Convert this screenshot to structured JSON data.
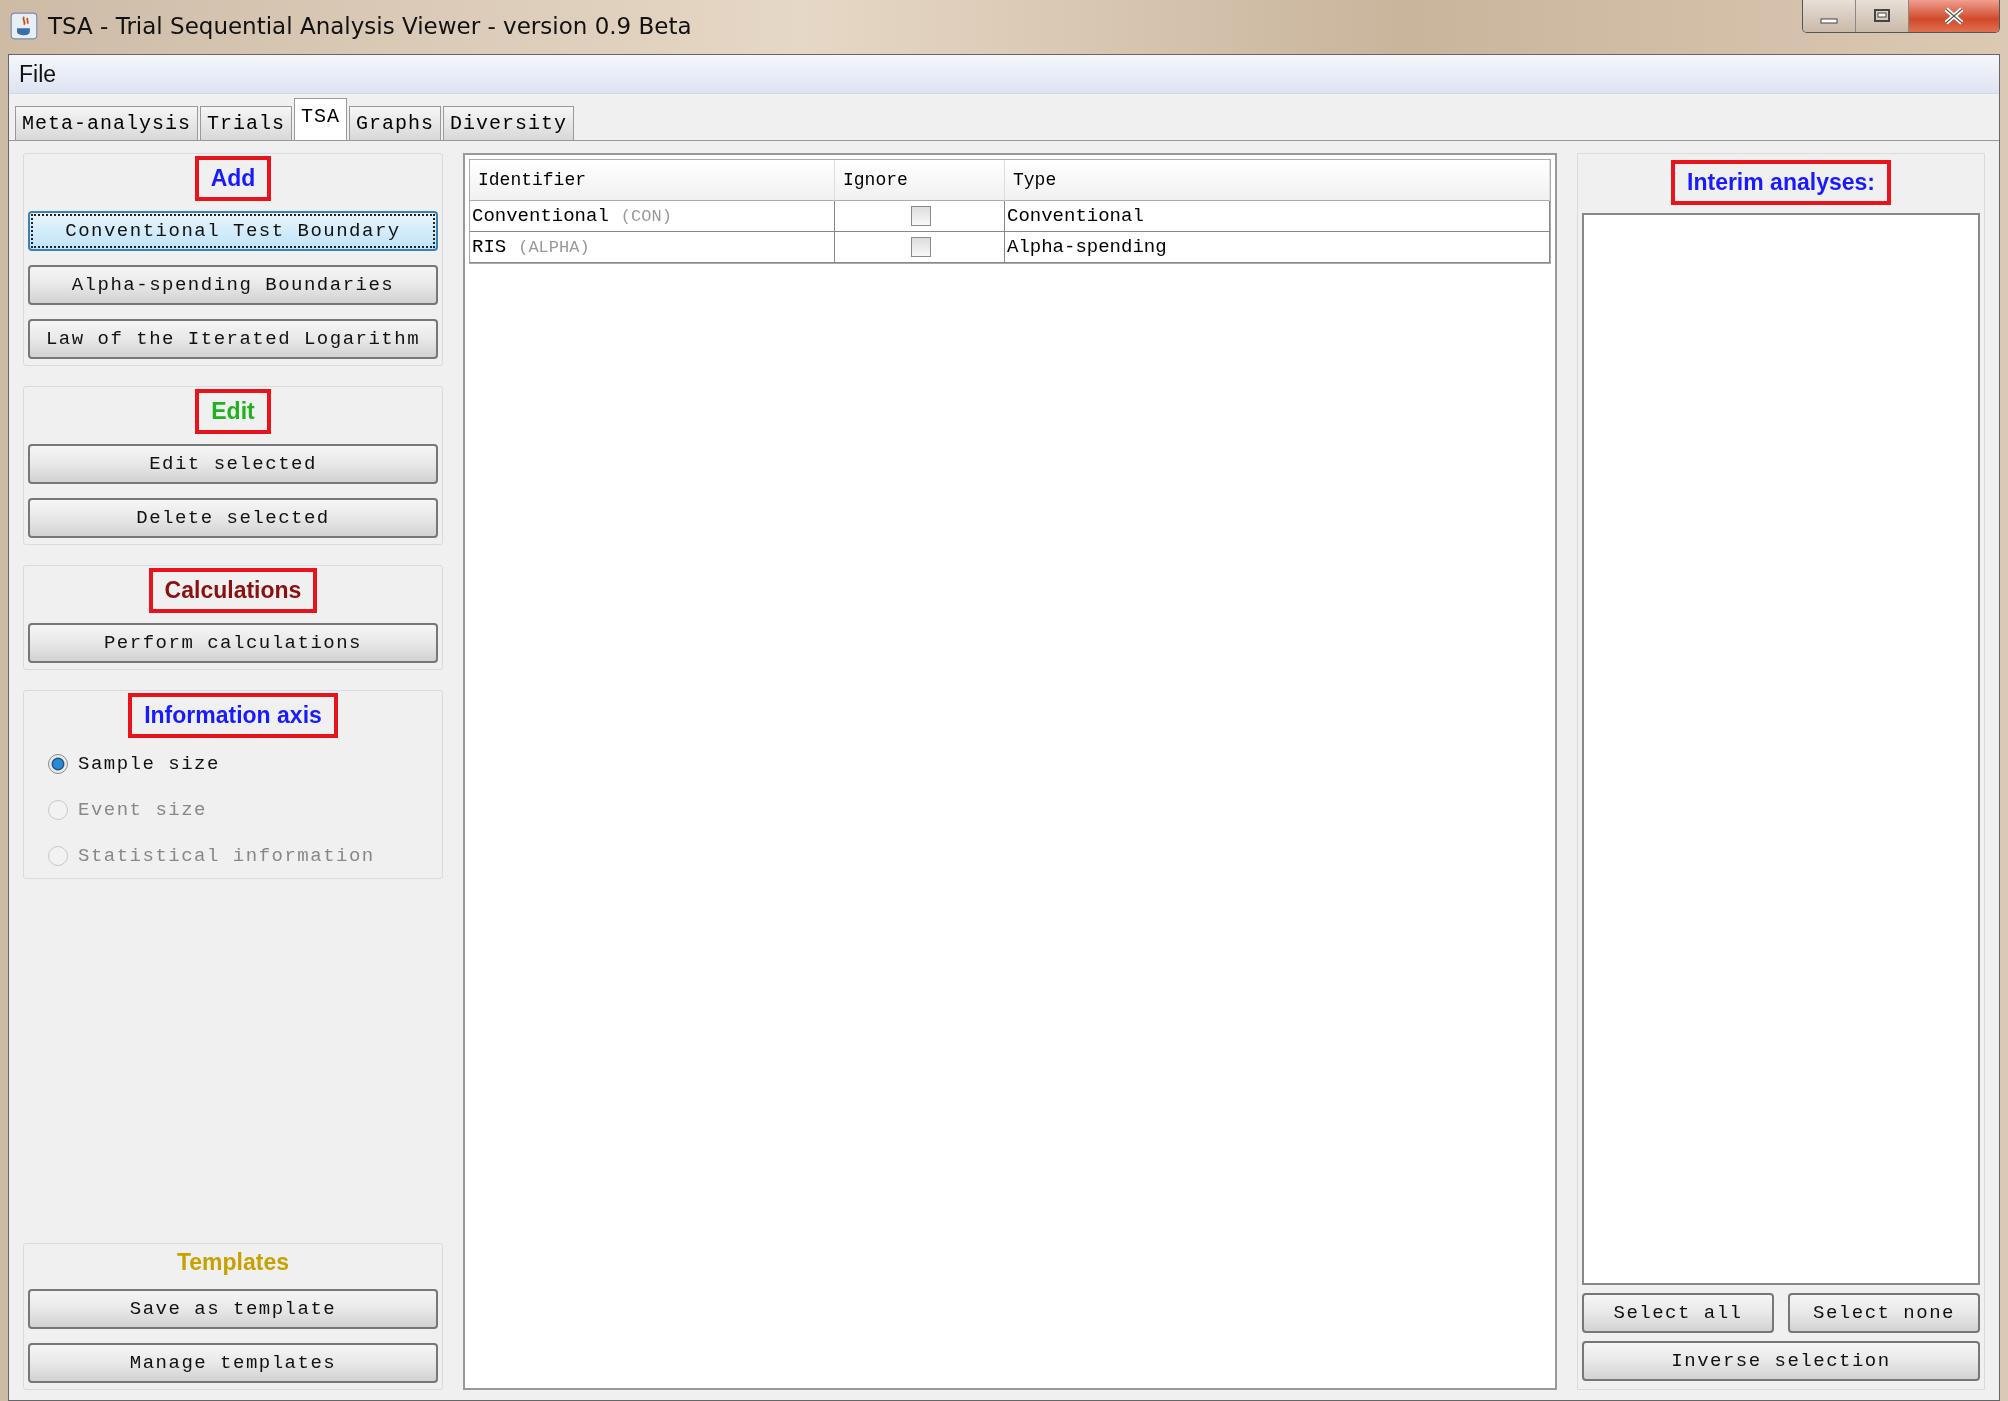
{
  "window": {
    "title": "TSA - Trial Sequential Analysis Viewer - version 0.9 Beta"
  },
  "menu": [
    "File"
  ],
  "tabs": [
    {
      "label": "Meta-analysis",
      "selected": false
    },
    {
      "label": "Trials",
      "selected": false
    },
    {
      "label": "TSA",
      "selected": true
    },
    {
      "label": "Graphs",
      "selected": false
    },
    {
      "label": "Diversity",
      "selected": false
    }
  ],
  "left_groups": [
    {
      "heading": "Add",
      "color": "#1a1aff",
      "highlighted": true,
      "kind": "buttons",
      "buttons": [
        {
          "label": "Conventional Test Boundary",
          "focused": true
        },
        {
          "label": "Alpha-spending Boundaries",
          "focused": false
        },
        {
          "label": "Law of the Iterated Logarithm",
          "focused": false
        }
      ]
    },
    {
      "heading": "Edit",
      "color": "#20b020",
      "highlighted": true,
      "kind": "buttons",
      "buttons": [
        {
          "label": "Edit selected",
          "focused": false
        },
        {
          "label": "Delete selected",
          "focused": false
        }
      ]
    },
    {
      "heading": "Calculations",
      "color": "#8b1010",
      "highlighted": true,
      "kind": "buttons",
      "buttons": [
        {
          "label": "Perform calculations",
          "focused": false
        }
      ]
    },
    {
      "heading": "Information axis",
      "color": "#1a1aff",
      "highlighted": true,
      "kind": "radios",
      "options": [
        {
          "label": "Sample size",
          "selected": true,
          "disabled": false
        },
        {
          "label": "Event size",
          "selected": false,
          "disabled": true
        },
        {
          "label": "Statistical information",
          "selected": false,
          "disabled": true
        }
      ]
    }
  ],
  "bottom_group": {
    "heading": "Templates",
    "color": "#c8a000",
    "highlighted": false,
    "kind": "buttons",
    "buttons": [
      {
        "label": "Save as template",
        "focused": false
      },
      {
        "label": "Manage templates",
        "focused": false
      }
    ]
  },
  "table": {
    "columns": [
      "Identifier",
      "Ignore",
      "Type"
    ],
    "rows": [
      {
        "identifier": "Conventional",
        "code": "(CON)",
        "ignore": false,
        "type": "Conventional"
      },
      {
        "identifier": "RIS",
        "code": "(ALPHA)",
        "ignore": false,
        "type": "Alpha-spending"
      }
    ]
  },
  "interim": {
    "heading": "Interim analyses:",
    "color": "#1a1aff",
    "highlighted": true,
    "buttons": [
      "Select all",
      "Select none"
    ],
    "wide_button": "Inverse selection"
  }
}
